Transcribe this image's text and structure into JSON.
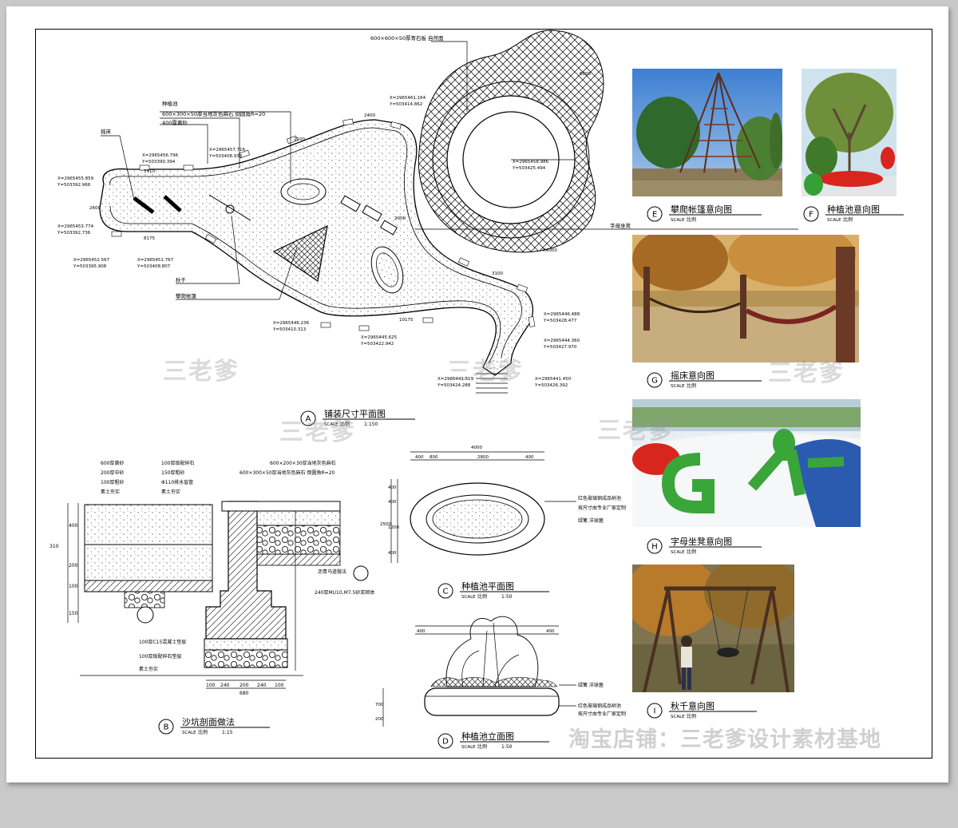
{
  "titles": {
    "A": {
      "letter": "A",
      "name": "铺装尺寸平面图",
      "scale_word": "SCALE",
      "scale_cn": "比例",
      "ratio": "1:150"
    },
    "B": {
      "letter": "B",
      "name": "沙坑剖面做法",
      "scale_word": "SCALE",
      "scale_cn": "比例",
      "ratio": "1:15"
    },
    "C": {
      "letter": "C",
      "name": "种植池平面图",
      "scale_word": "SCALE",
      "scale_cn": "比例",
      "ratio": "1:50"
    },
    "D": {
      "letter": "D",
      "name": "种植池立面图",
      "scale_word": "SCALE",
      "scale_cn": "比例",
      "ratio": "1:50"
    },
    "E": {
      "letter": "E",
      "name": "攀爬帐篷意向图",
      "scale_word": "SCALE",
      "scale_cn": "比例"
    },
    "F": {
      "letter": "F",
      "name": "种植池意向图",
      "scale_word": "SCALE",
      "scale_cn": "比例"
    },
    "G": {
      "letter": "G",
      "name": "摇床意向图",
      "scale_word": "SCALE",
      "scale_cn": "比例"
    },
    "H": {
      "letter": "H",
      "name": "字母坐凳意向图",
      "scale_word": "SCALE",
      "scale_cn": "比例"
    },
    "I": {
      "letter": "I",
      "name": "秋千意向图",
      "scale_word": "SCALE",
      "scale_cn": "比例"
    }
  },
  "plan_labels": {
    "top_paving": "600×600×50厚青石板 自然面",
    "planting_pool": "种植池",
    "granite": "600×300×50厚当地灰色麻石 倒圆角R=20",
    "sand": "400厚黄砂",
    "hammock": "摇床",
    "swing": "秋千",
    "climbing_tent": "攀爬帐篷",
    "letter_bench": "字母坐凳",
    "coords": [
      "X=2965456.796",
      "Y=503390.394",
      "X=2965457.716",
      "Y=503408.933",
      "X=2965461.164",
      "Y=503414.862",
      "X=2965458.986",
      "Y=503425.494",
      "X=2965455.859",
      "Y=503392.966",
      "X=2965453.774",
      "Y=503392.736",
      "X=2965452.567",
      "Y=503395.908",
      "X=2965451.767",
      "Y=503408.807",
      "X=2965446.236",
      "Y=503410.313",
      "X=2965445.625",
      "Y=503422.942",
      "X=2965446.488",
      "Y=503428.477",
      "X=2965444.360",
      "Y=503427.970",
      "X=2965441.450",
      "Y=503426.392",
      "X=2965441.519",
      "Y=503424.288"
    ],
    "dims": [
      "5510",
      "8175",
      "2600",
      "10175",
      "3100",
      "6000",
      "2000",
      "R6000",
      "2100",
      "2400"
    ]
  },
  "section_labels": {
    "left": [
      "600厚黄砂",
      "200厚中砂",
      "100厚粗砂",
      "素土夯实"
    ],
    "mid": [
      "100厚级配碎石",
      "150厚粗砂",
      "Φ110排水盲管",
      "素土夯实"
    ],
    "top1": "600×200×30厚当地灰色麻石",
    "top2": "600×300×50厚当地灰色麻石 倒圆角R=20",
    "right1": "沥青马道做法",
    "right2": "240厚MU10,M7.5砂浆砌体",
    "bottom1": "100厚C15混凝土垫层",
    "bottom2": "100厚级配碎石垫层",
    "bottom3": "素土夯实",
    "dims_v": [
      "310",
      "400",
      "200",
      "100",
      "150"
    ],
    "dims_h": [
      "100",
      "240",
      "200",
      "240",
      "100",
      "680"
    ]
  },
  "pool_labels": {
    "plan_dims": [
      "4000",
      "400",
      "800",
      "2800",
      "400",
      "400",
      "2500",
      "400",
      "1200",
      "400"
    ],
    "plan_note1": "红色玻璃钢成品树池",
    "plan_note2": "按尺寸由专业厂家定制",
    "plan_note3": "绿篱 洋球菌",
    "elev_note1": "绿篱 洋球菌",
    "elev_note2": "红色玻璃钢成品树池",
    "elev_note3": "按尺寸由专业厂家定制",
    "elev_dims": [
      "400",
      "400",
      "700",
      "200"
    ]
  },
  "watermarks": [
    "三老爹",
    "三老爹",
    "三老爹",
    "三老爹",
    "三老爹"
  ],
  "shop_text": "淘宝店铺：三老爹设计素材基地"
}
